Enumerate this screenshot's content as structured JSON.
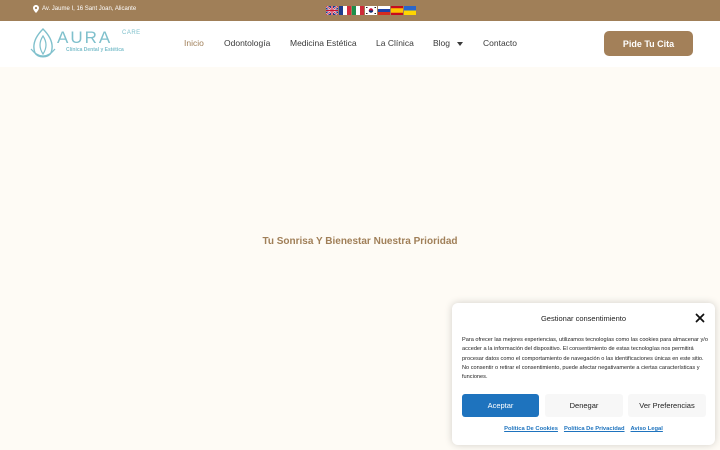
{
  "topbar": {
    "address": "Av. Jaume I, 16 Sant Joan, Alicante",
    "flags": [
      "english-flag",
      "french-flag",
      "italian-flag",
      "korean-flag",
      "russian-flag",
      "spanish-flag",
      "ukrainian-flag"
    ]
  },
  "logo": {
    "brand": "AURA",
    "care": "CARE",
    "subtitle": "Clínica Dental y Estética"
  },
  "nav": {
    "items": [
      {
        "label": "Inicio"
      },
      {
        "label": "Odontología"
      },
      {
        "label": "Medicina Estética"
      },
      {
        "label": "La Clínica"
      },
      {
        "label": "Blog"
      },
      {
        "label": "Contacto"
      }
    ],
    "cta": "Pide Tu Cita"
  },
  "hero": {
    "title": "Tu Sonrisa Y Bienestar Nuestra Prioridad"
  },
  "consent": {
    "title": "Gestionar consentimiento",
    "body": "Para ofrecer las mejores experiencias, utilizamos tecnologías como las cookies para almacenar y/o acceder a la información del dispositivo. El consentimiento de estas tecnologías nos permitirá procesar datos como el comportamiento de navegación o las identificaciones únicas en este sitio. No consentir o retirar el consentimiento, puede afectar negativamente a ciertas características y funciones.",
    "accept": "Aceptar",
    "deny": "Denegar",
    "preferences": "Ver Preferencias",
    "links": [
      "Política De Cookies",
      "Política De Privacidad",
      "Aviso Legal"
    ]
  },
  "colors": {
    "brand": "#a07f58",
    "accent": "#1e73be",
    "logo": "#7fc0cc"
  }
}
